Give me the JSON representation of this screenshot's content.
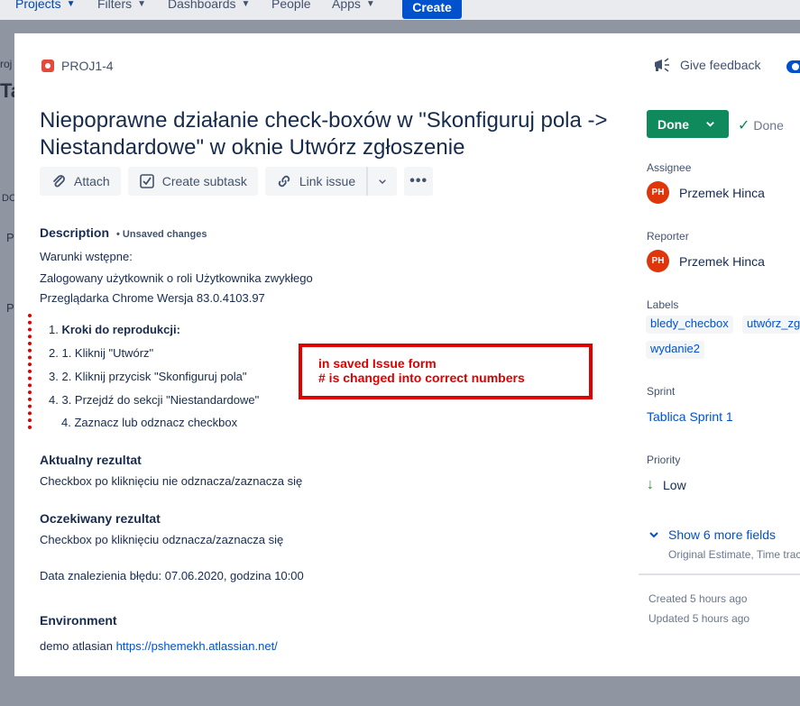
{
  "topnav": {
    "items": [
      "Projects",
      "Filters",
      "Dashboards",
      "People",
      "Apps"
    ],
    "create": "Create"
  },
  "bg_fragments": [
    "roj",
    "Ta",
    "DC",
    "P",
    "P"
  ],
  "issue": {
    "key": "PROJ1-4",
    "feedback": "Give feedback",
    "title": "Niepoprawne działanie check-boxów w \"Skonfiguruj pola -> Niestandardowe\" w oknie Utwórz zgłoszenie"
  },
  "toolbar": {
    "attach": "Attach",
    "create_subtask": "Create subtask",
    "link_issue": "Link issue",
    "more": "•••"
  },
  "description": {
    "heading": "Description",
    "unsaved": "• Unsaved changes",
    "lines": [
      "Warunki wstępne:",
      "Zalogowany użytkownik o roli Użytkownika zwykłego",
      "Przeglądarka Chrome Wersja 83.0.4103.97"
    ],
    "steps": [
      {
        "num": "1.",
        "text": "Kroki do reprodukcji:"
      },
      {
        "num": "2.",
        "text": "1. Kliknij \"Utwórz\""
      },
      {
        "num": "3.",
        "text": "2. Kliknij przycisk \"Skonfiguruj pola\""
      },
      {
        "num": "4.",
        "text": "3. Przejdź do sekcji \"Niestandardowe\""
      },
      {
        "num": "",
        "text": "4. Zaznacz lub odznacz checkbox"
      }
    ],
    "actual_heading": "Aktualny rezultat",
    "actual_text": "Checkbox po kliknięciu nie odznacza/zaznacza się",
    "expected_heading": "Oczekiwany rezultat",
    "expected_text": "Checkbox po kliknięciu odznacza/zaznacza się",
    "found_date": "Data znalezienia błędu: 07.06.2020, godzina 10:00"
  },
  "annotation": {
    "line1": "in saved Issue form",
    "line2": "# is changed into correct numbers"
  },
  "environment": {
    "heading": "Environment",
    "prefix": "demo atlasian",
    "url": "https://pshemekh.atlassian.net/"
  },
  "sidebar": {
    "status_button": "Done",
    "status_text": "Done",
    "assignee_label": "Assignee",
    "assignee_initials": "PH",
    "assignee_name": "Przemek Hinca",
    "reporter_label": "Reporter",
    "reporter_initials": "PH",
    "reporter_name": "Przemek Hinca",
    "labels_label": "Labels",
    "labels": [
      "bledy_checbox",
      "utwórz_zg",
      "wydanie2"
    ],
    "sprint_label": "Sprint",
    "sprint_value": "Tablica Sprint 1",
    "priority_label": "Priority",
    "priority_value": "Low",
    "show_more": "Show 6 more fields",
    "show_more_sub": "Original Estimate, Time trac",
    "created": "Created 5 hours ago",
    "updated": "Updated 5 hours ago"
  },
  "colors": {
    "accent": "#0052cc",
    "done_green": "#0f8a5c",
    "annotation_red": "#e00000",
    "avatar_red": "#de350b"
  }
}
